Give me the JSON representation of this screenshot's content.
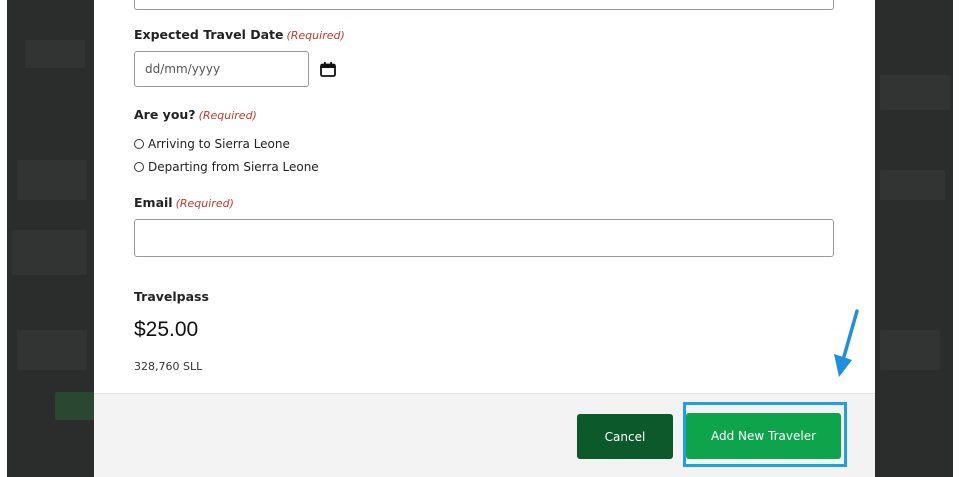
{
  "form": {
    "travel_date": {
      "label": "Expected Travel Date",
      "required_tag": "(Required)",
      "placeholder": "dd/mm/yyyy"
    },
    "are_you": {
      "label": "Are you?",
      "required_tag": "(Required)",
      "options": [
        {
          "label": "Arriving to Sierra Leone",
          "selected": false
        },
        {
          "label": "Departing from Sierra Leone",
          "selected": false
        }
      ]
    },
    "email": {
      "label": "Email",
      "required_tag": "(Required)",
      "value": ""
    }
  },
  "product": {
    "name": "Travelpass",
    "price": "$25.00",
    "local_price": "328,760 SLL"
  },
  "footer": {
    "cancel_label": "Cancel",
    "add_label": "Add New Traveler"
  },
  "icons": {
    "calendar": "calendar-icon",
    "annotation_arrow": "arrow-icon"
  },
  "colors": {
    "primary_green": "#0ea44c",
    "dark_green": "#0c5a2c",
    "required_red": "#c0392b",
    "highlight_blue": "#1fa0e6",
    "backdrop": "#2b2d2c"
  }
}
